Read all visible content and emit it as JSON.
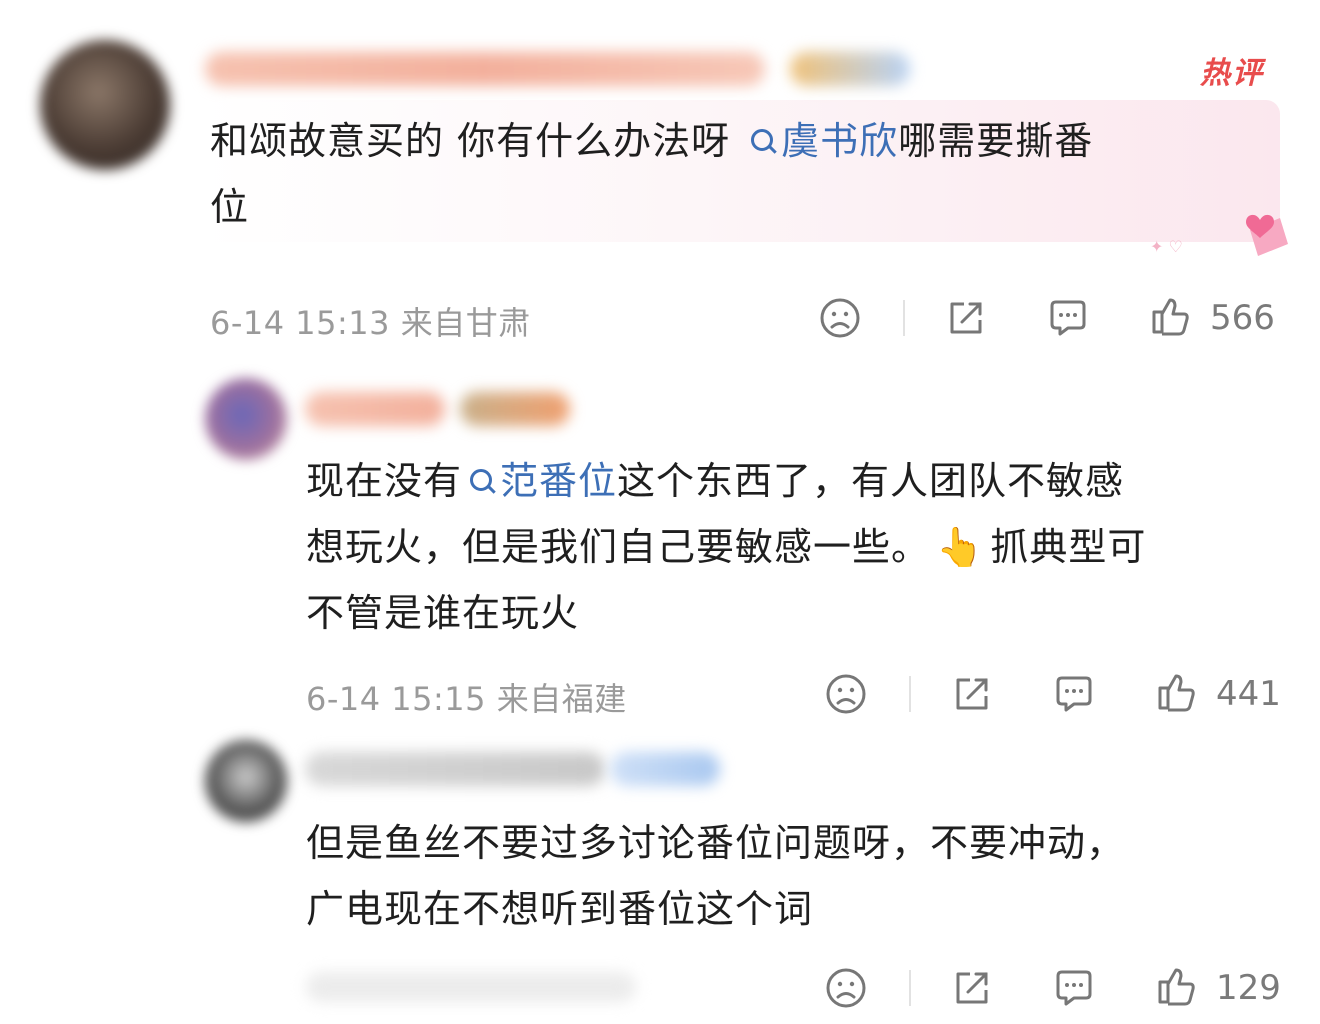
{
  "comments": [
    {
      "text_parts": [
        "和颂故意买的 你有什么办法呀 ",
        "虞书欣",
        "哪需要撕番",
        "位"
      ],
      "badge": "热评",
      "meta": "6-14 15:13 来自甘肃",
      "likes": "566"
    },
    {
      "text_parts": [
        "现在没有",
        "范番位",
        "这个东西了，有人团队不敏感",
        "想玩火，但是我们自己要敏感一些。",
        "👆",
        "抓典型可",
        "不管是谁在玩火"
      ],
      "meta": "6-14 15:15 来自福建",
      "likes": "441"
    },
    {
      "text_parts": [
        "但是鱼丝不要过多讨论番位问题呀，不要冲动，",
        "广电现在不想听到番位这个词"
      ],
      "likes": "129"
    }
  ],
  "icons": [
    "sad-face-icon",
    "share-icon",
    "comment-icon",
    "thumbs-up-icon"
  ],
  "colors": {
    "link": "#3d6fb6",
    "hot": "#e84c4c",
    "meta": "#9a9a9a"
  }
}
